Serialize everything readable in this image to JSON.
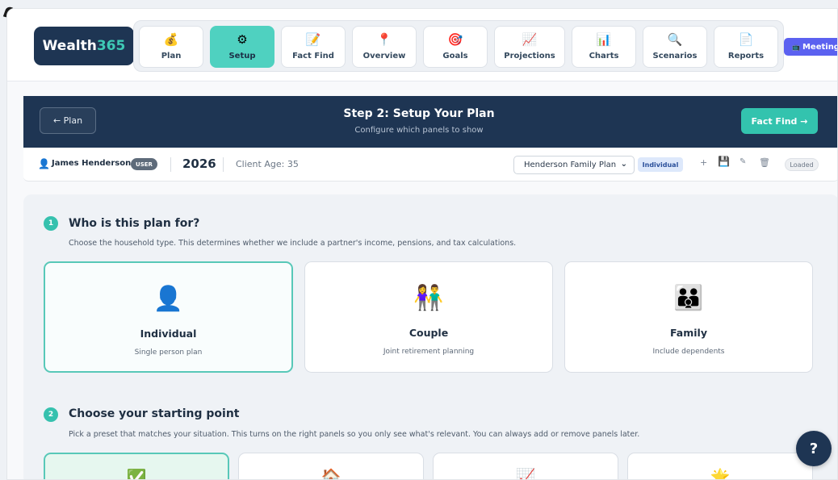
{
  "brand": {
    "name": "Wealth",
    "accent": "365"
  },
  "nav": [
    {
      "label": "Plan",
      "icon": "💰",
      "icon_name": "money-bag-icon"
    },
    {
      "label": "Setup",
      "icon": "⚙",
      "icon_name": "gear-icon",
      "active": true
    },
    {
      "label": "Fact Find",
      "icon": "📝",
      "icon_name": "memo-icon"
    },
    {
      "label": "Overview",
      "icon": "📍",
      "icon_name": "pin-icon"
    },
    {
      "label": "Goals",
      "icon": "🎯",
      "icon_name": "target-icon"
    },
    {
      "label": "Projections",
      "icon": "📈",
      "icon_name": "chart-up-icon"
    },
    {
      "label": "Charts",
      "icon": "📊",
      "icon_name": "bar-chart-icon"
    },
    {
      "label": "Scenarios",
      "icon": "🔍",
      "icon_name": "magnifier-icon"
    },
    {
      "label": "Reports",
      "icon": "📄",
      "icon_name": "document-icon"
    }
  ],
  "meeting": {
    "icon": "📺",
    "label": "Meeting"
  },
  "step": {
    "back_label": "← Plan",
    "title": "Step 2: Setup Your Plan",
    "subtitle": "Configure which panels to show",
    "next_label": "Fact Find →"
  },
  "client": {
    "name": "James Henderson",
    "role_badge": "USER",
    "year": "2026",
    "age_text": "Client Age: 35",
    "plan_name": "Henderson Family Plan",
    "plan_type_badge": "Individual",
    "status": "Loaded"
  },
  "toolbar": {
    "add": "+",
    "save": "💾",
    "edit": "✎",
    "delete": "🗑"
  },
  "section1": {
    "number": "1",
    "title": "Who is this plan for?",
    "description": "Choose the household type. This determines whether we include a partner's income, pensions, and tax calculations."
  },
  "household_options": [
    {
      "icon": "👤",
      "icon_name": "person-icon",
      "title": "Individual",
      "subtitle": "Single person plan",
      "selected": true
    },
    {
      "icon": "👫",
      "icon_name": "couple-icon",
      "title": "Couple",
      "subtitle": "Joint retirement planning"
    },
    {
      "icon": "👪",
      "icon_name": "family-icon",
      "title": "Family",
      "subtitle": "Include dependents"
    }
  ],
  "section2": {
    "number": "2",
    "title": "Choose your starting point",
    "description": "Pick a preset that matches your situation. This turns on the right panels so you only see what's relevant. You can always add or remove panels later."
  },
  "presets": [
    {
      "icon": "✅",
      "icon_name": "check-icon",
      "selected": true
    },
    {
      "icon": "🏠",
      "icon_name": "house-icon"
    },
    {
      "icon": "📈",
      "icon_name": "chart-up-icon"
    },
    {
      "icon": "🌟",
      "icon_name": "star-icon"
    }
  ],
  "help": {
    "label": "?"
  },
  "colors": {
    "navy": "#1e3553",
    "teal": "#36c1ae",
    "meeting": "#5b61f0"
  }
}
